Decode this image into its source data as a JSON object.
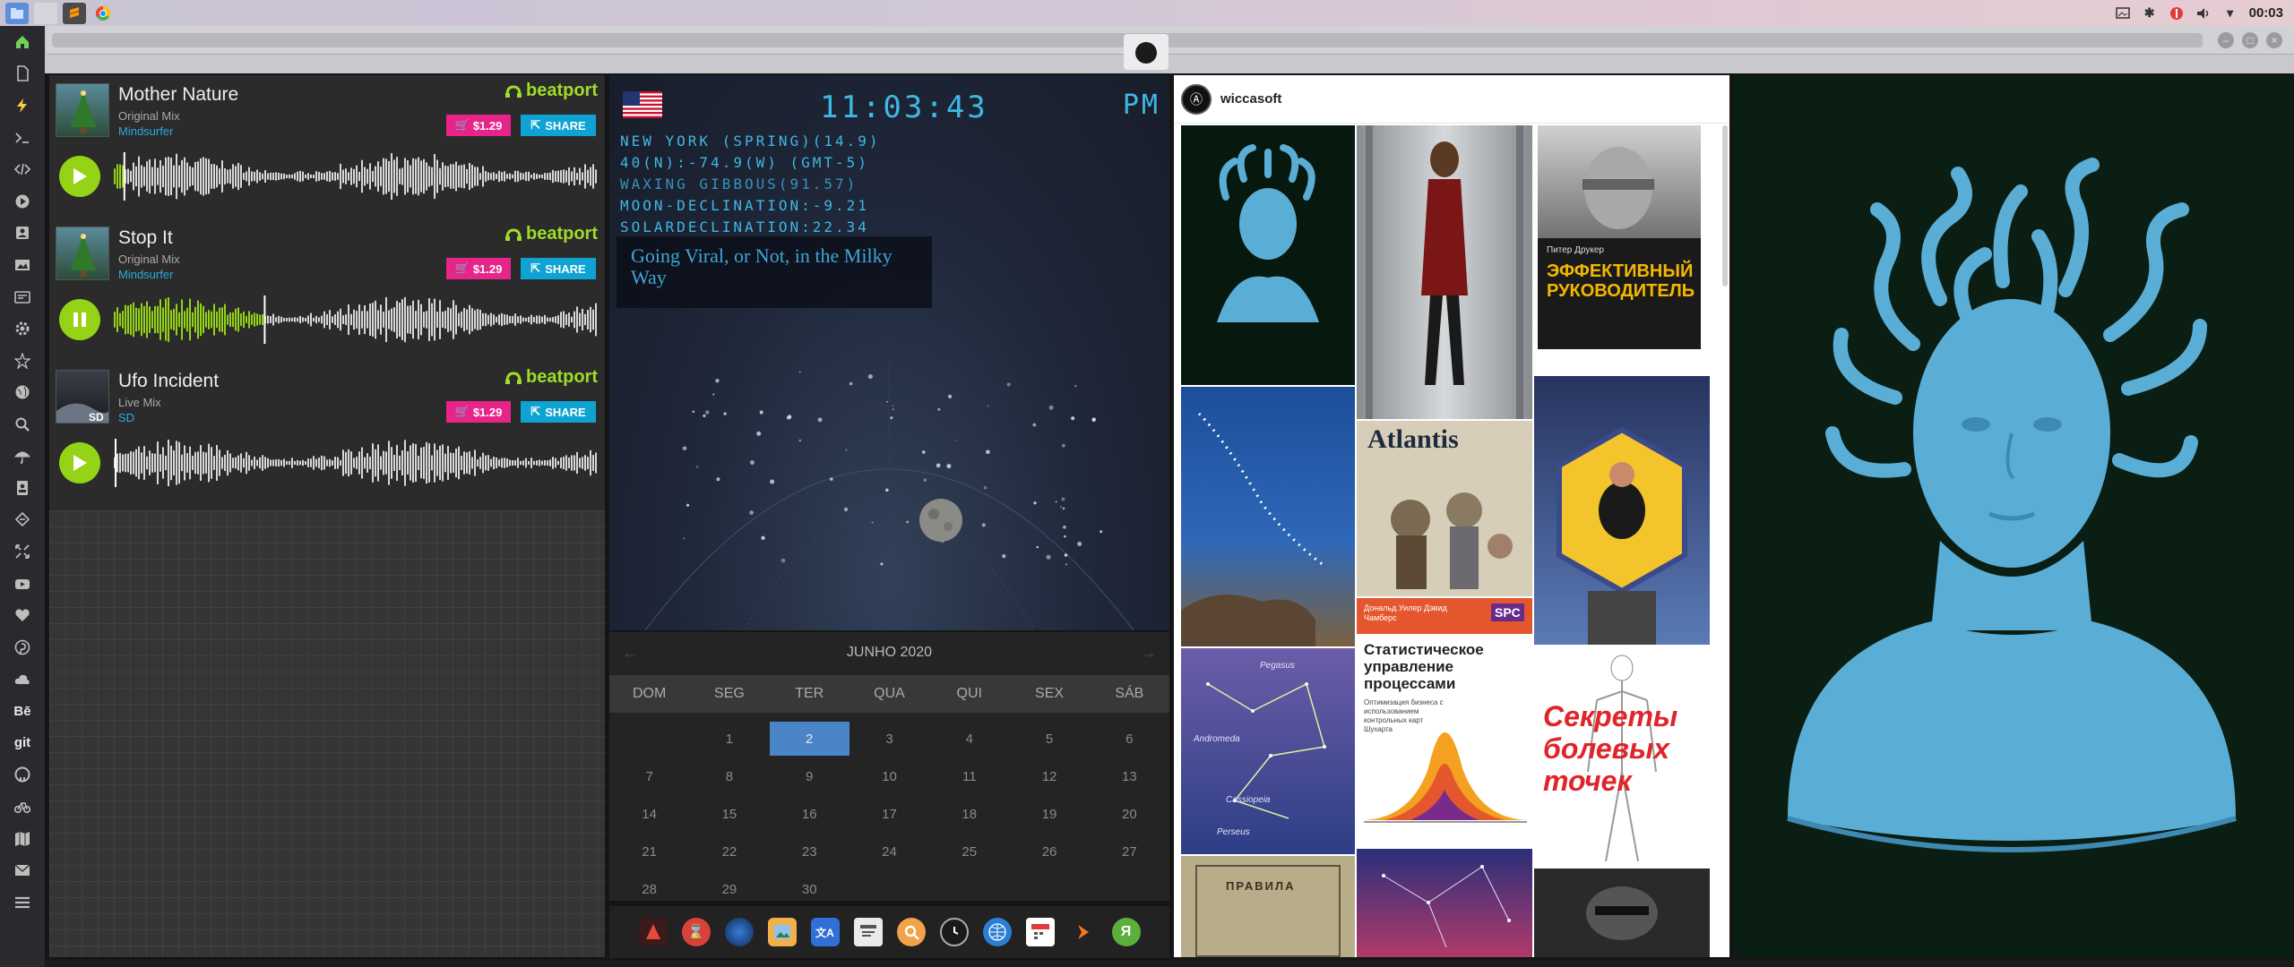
{
  "system": {
    "clock": "00:03",
    "tray_icons": [
      "photo-icon",
      "bluetooth-icon",
      "network-icon",
      "volume-icon",
      "wifi-icon"
    ]
  },
  "launcher": [
    "home-icon",
    "document-icon",
    "lightning-icon",
    "terminal-icon",
    "code-icon",
    "play-icon",
    "contacts-icon",
    "image-icon",
    "card-icon",
    "settings-icon",
    "star-icon",
    "globe-icon",
    "search-icon",
    "umbrella-icon",
    "id-icon",
    "airplane-icon",
    "expand-icon",
    "youtube-icon",
    "heart-icon",
    "pinterest-icon",
    "cloud-icon",
    "behance-icon",
    "git-icon",
    "github-icon",
    "bike-icon",
    "map-icon",
    "mail-icon",
    "list-icon"
  ],
  "launcher_text": {
    "behance": "Bē",
    "git": "git"
  },
  "beatport": {
    "brand": "beatport",
    "tracks": [
      {
        "title": "Mother Nature",
        "mix": "Original Mix",
        "artist": "Mindsurfer",
        "price": "$1.29",
        "share": "SHARE",
        "state": "play",
        "progress": 0.02
      },
      {
        "title": "Stop It",
        "mix": "Original Mix",
        "artist": "Mindsurfer",
        "price": "$1.29",
        "share": "SHARE",
        "state": "pause",
        "progress": 0.31
      },
      {
        "title": "Ufo Incident",
        "mix": "Live Mix",
        "artist": "SD",
        "price": "$1.29",
        "share": "SHARE",
        "state": "play",
        "progress": 0.0
      }
    ],
    "colors": {
      "accent": "#94d316",
      "price": "#e7248a",
      "share": "#0fa3d3"
    }
  },
  "clock": {
    "time": "11:03:43",
    "ampm": "PM",
    "lines": [
      "NEW YORK (SPRING)(14.9)",
      "40(N):-74.9(W) (GMT-5)",
      "WAXING GIBBOUS(91.57)",
      "MOON-DECLINATION:-9.21",
      "SOLARDECLINATION:22.34"
    ],
    "headline": "Going Viral, or Not, in the Milky Way"
  },
  "calendar": {
    "month": "JUNHO 2020",
    "weekdays": [
      "DOM",
      "SEG",
      "TER",
      "QUA",
      "QUI",
      "SEX",
      "SÁB"
    ],
    "weeks": [
      [
        "",
        "1",
        "2",
        "3",
        "4",
        "5",
        "6"
      ],
      [
        "7",
        "8",
        "9",
        "10",
        "11",
        "12",
        "13"
      ],
      [
        "14",
        "15",
        "16",
        "17",
        "18",
        "19",
        "20"
      ],
      [
        "21",
        "22",
        "23",
        "24",
        "25",
        "26",
        "27"
      ],
      [
        "28",
        "29",
        "30",
        "",
        "",
        "",
        ""
      ]
    ],
    "today": "2"
  },
  "dock": [
    "vlc-icon",
    "hourglass-icon",
    "earth-icon",
    "preview-icon",
    "translate-icon",
    "calendar-list-icon",
    "finder-icon",
    "clock-icon",
    "globe-icon",
    "calendar-icon",
    "arrow-icon",
    "yandex-icon"
  ],
  "dock_text": {
    "yandex": "Я"
  },
  "instagram": {
    "username": "wiccasoft",
    "tiles": {
      "book1_author": "Питер Друкер",
      "book1_title": "ЭФФЕКТИВНЫЙ РУКОВОДИТЕЛЬ",
      "atlantis": "Atlantis",
      "book2_authors": "Дональд Уилер Дэвид Чамберс",
      "book2_badge": "SPC",
      "book2_title": "Статистическое управление процессами",
      "book2_sub": "Оптимизация бизнеса с использованием контрольных карт Шухарта",
      "book3_title": "Секреты болевых точек",
      "constellation1": "Pegasus",
      "constellation2": "Andromeda",
      "constellation3": "Cassiopeia",
      "constellation4": "Perseus",
      "old_book": "ПРАВИЛА"
    }
  }
}
